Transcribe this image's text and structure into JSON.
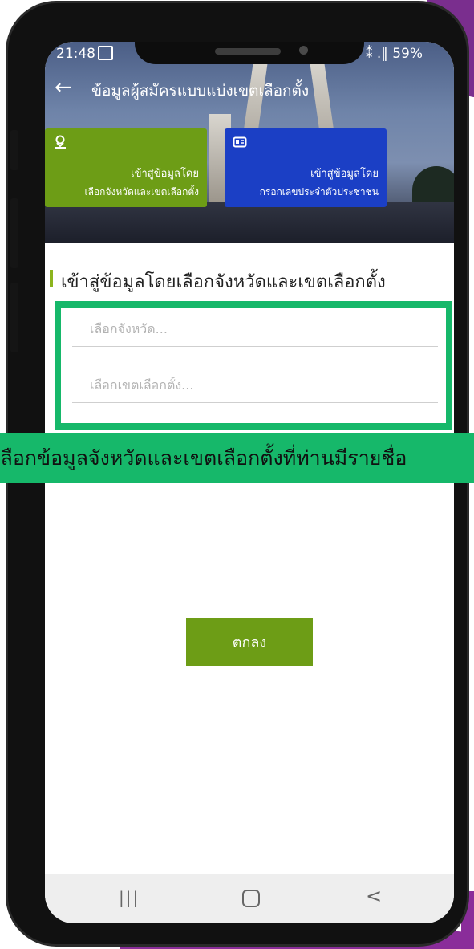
{
  "status_bar": {
    "time": "21:48",
    "right": "⁑ .‖ 59%"
  },
  "app_bar": {
    "title": "ข้อมูลผู้สมัครแบบแบ่งเขตเลือกตั้ง"
  },
  "cards": [
    {
      "line1": "เข้าสู่ข้อมูลโดย",
      "line2": "เลือกจังหวัดและเขตเลือกตั้ง",
      "icon": "location-pin-icon",
      "color": "#6d9d16"
    },
    {
      "line1": "เข้าสู่ข้อมูลโดย",
      "line2": "กรอกเลขประจำตัวประชาชน",
      "icon": "id-card-icon",
      "color": "#1b3fc5"
    }
  ],
  "section": {
    "title": "เข้าสู่ข้อมูลโดยเลือกจังหวัดและเขตเลือกตั้ง"
  },
  "fields": {
    "province_placeholder": "เลือกจังหวัด...",
    "district_placeholder": "เลือกเขตเลือกตั้ง..."
  },
  "caption": "เลือกข้อมูลจังหวัดและเขตเลือกตั้งที่ท่านมีรายชื่อ",
  "ok_button": "ตกลง",
  "colors": {
    "highlight": "#16b86a",
    "accent_green": "#6d9d16",
    "accent_blue": "#1b3fc5",
    "brand_purple": "#7a2e8e"
  }
}
